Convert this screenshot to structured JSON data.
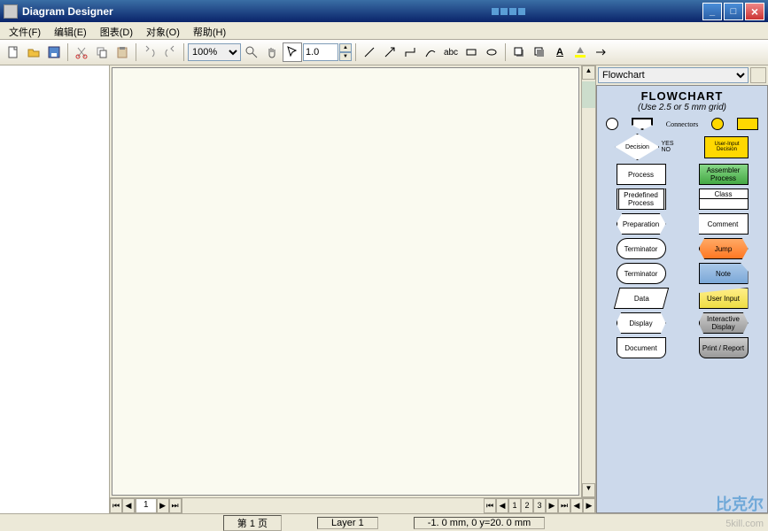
{
  "app": {
    "title": "Diagram Designer"
  },
  "menu": {
    "file": "文件(F)",
    "edit": "编辑(E)",
    "diagram": "图表(D)",
    "object": "对象(O)",
    "help": "帮助(H)"
  },
  "toolbar": {
    "zoom": "100%",
    "spin": "1.0",
    "text_tool": "abc",
    "underline": "A"
  },
  "tabs": {
    "page1": "1"
  },
  "status": {
    "page": "第 1 页",
    "layer": "Layer 1",
    "coords": "-1. 0 mm, 0 y=20. 0 mm"
  },
  "palette": {
    "select": "Flowchart",
    "title": "FLOWCHART",
    "subtitle": "(Use 2.5 or 5 mm grid)",
    "connectors": "Connectors",
    "decision": "Decision",
    "yes": "YES",
    "no": "NO",
    "userinput_dec": "User-Input Decision",
    "process": "Process",
    "assembler": "Assembler Process",
    "predefined": "Predefined Process",
    "class": "Class",
    "preparation": "Preparation",
    "comment": "Comment",
    "terminator": "Terminator",
    "jump": "Jump",
    "terminator2": "Terminator",
    "note": "Note",
    "data": "Data",
    "userinput": "User Input",
    "display": "Display",
    "interactive": "Interactive Display",
    "document": "Document",
    "print": "Print / Report"
  },
  "watermark": {
    "main": "比克尔",
    "sub": "5kill.com"
  }
}
